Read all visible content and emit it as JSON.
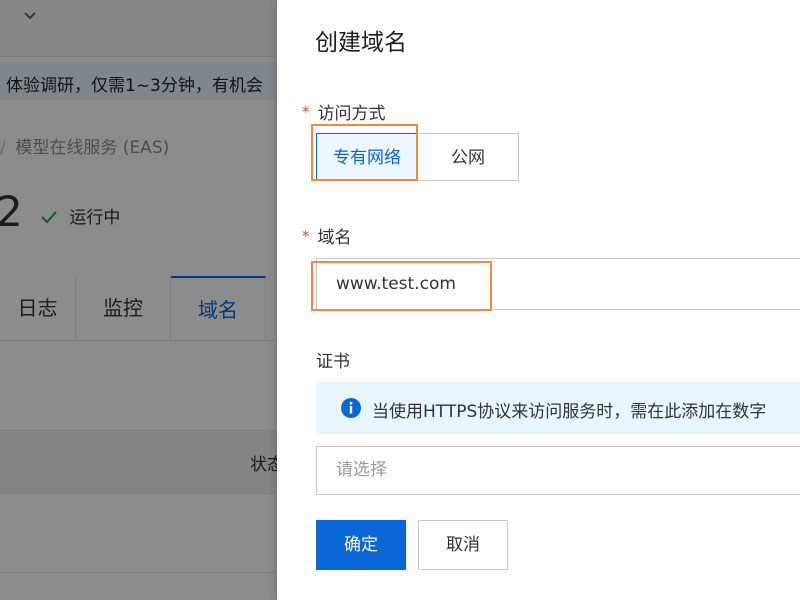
{
  "background": {
    "banner_text": "体验调研，仅需1~3分钟，有机会",
    "breadcrumb": "模型在线服务 (EAS)",
    "instance_number": "2",
    "status_text": "运行中",
    "tabs": [
      {
        "label": "日志"
      },
      {
        "label": "监控"
      },
      {
        "label": "域名"
      }
    ],
    "table_column": "状态"
  },
  "drawer": {
    "title": "创建域名",
    "access_method": {
      "label": "访问方式",
      "options": [
        "专有网络",
        "公网"
      ],
      "selected": "专有网络"
    },
    "domain": {
      "label": "域名",
      "value": "www.test.com"
    },
    "certificate": {
      "label": "证书",
      "info_text": "当使用HTTPS协议来访问服务时，需在此添加在数字",
      "select_placeholder": "请选择"
    },
    "buttons": {
      "confirm": "确定",
      "cancel": "取消"
    }
  },
  "colors": {
    "primary": "#0b67d6",
    "required": "#e14b2f",
    "highlight": "#f08a3c",
    "success": "#2aa24a",
    "info": "#0b67d6"
  },
  "icons": {
    "collapse": "chevron-down-icon",
    "status": "check-icon",
    "info": "info-icon"
  }
}
